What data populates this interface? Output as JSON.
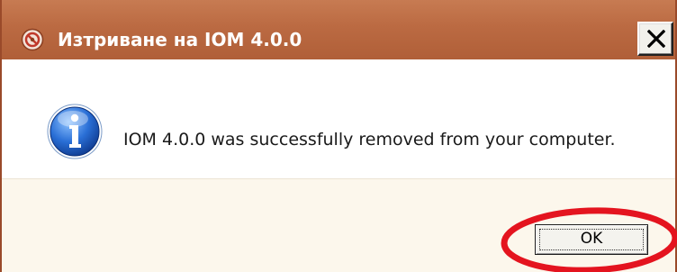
{
  "window": {
    "title": "Изтриване на IOM 4.0.0",
    "app_icon": "uninstall-app-icon",
    "close_icon": "close-x-icon"
  },
  "message": {
    "icon": "info-icon",
    "text": "IOM 4.0.0 was successfully removed from your computer."
  },
  "buttons": {
    "ok_label": "OK"
  },
  "colors": {
    "titlebar": "#bb6a42",
    "footer": "#fcf7ec",
    "annotation": "#e4141f"
  }
}
